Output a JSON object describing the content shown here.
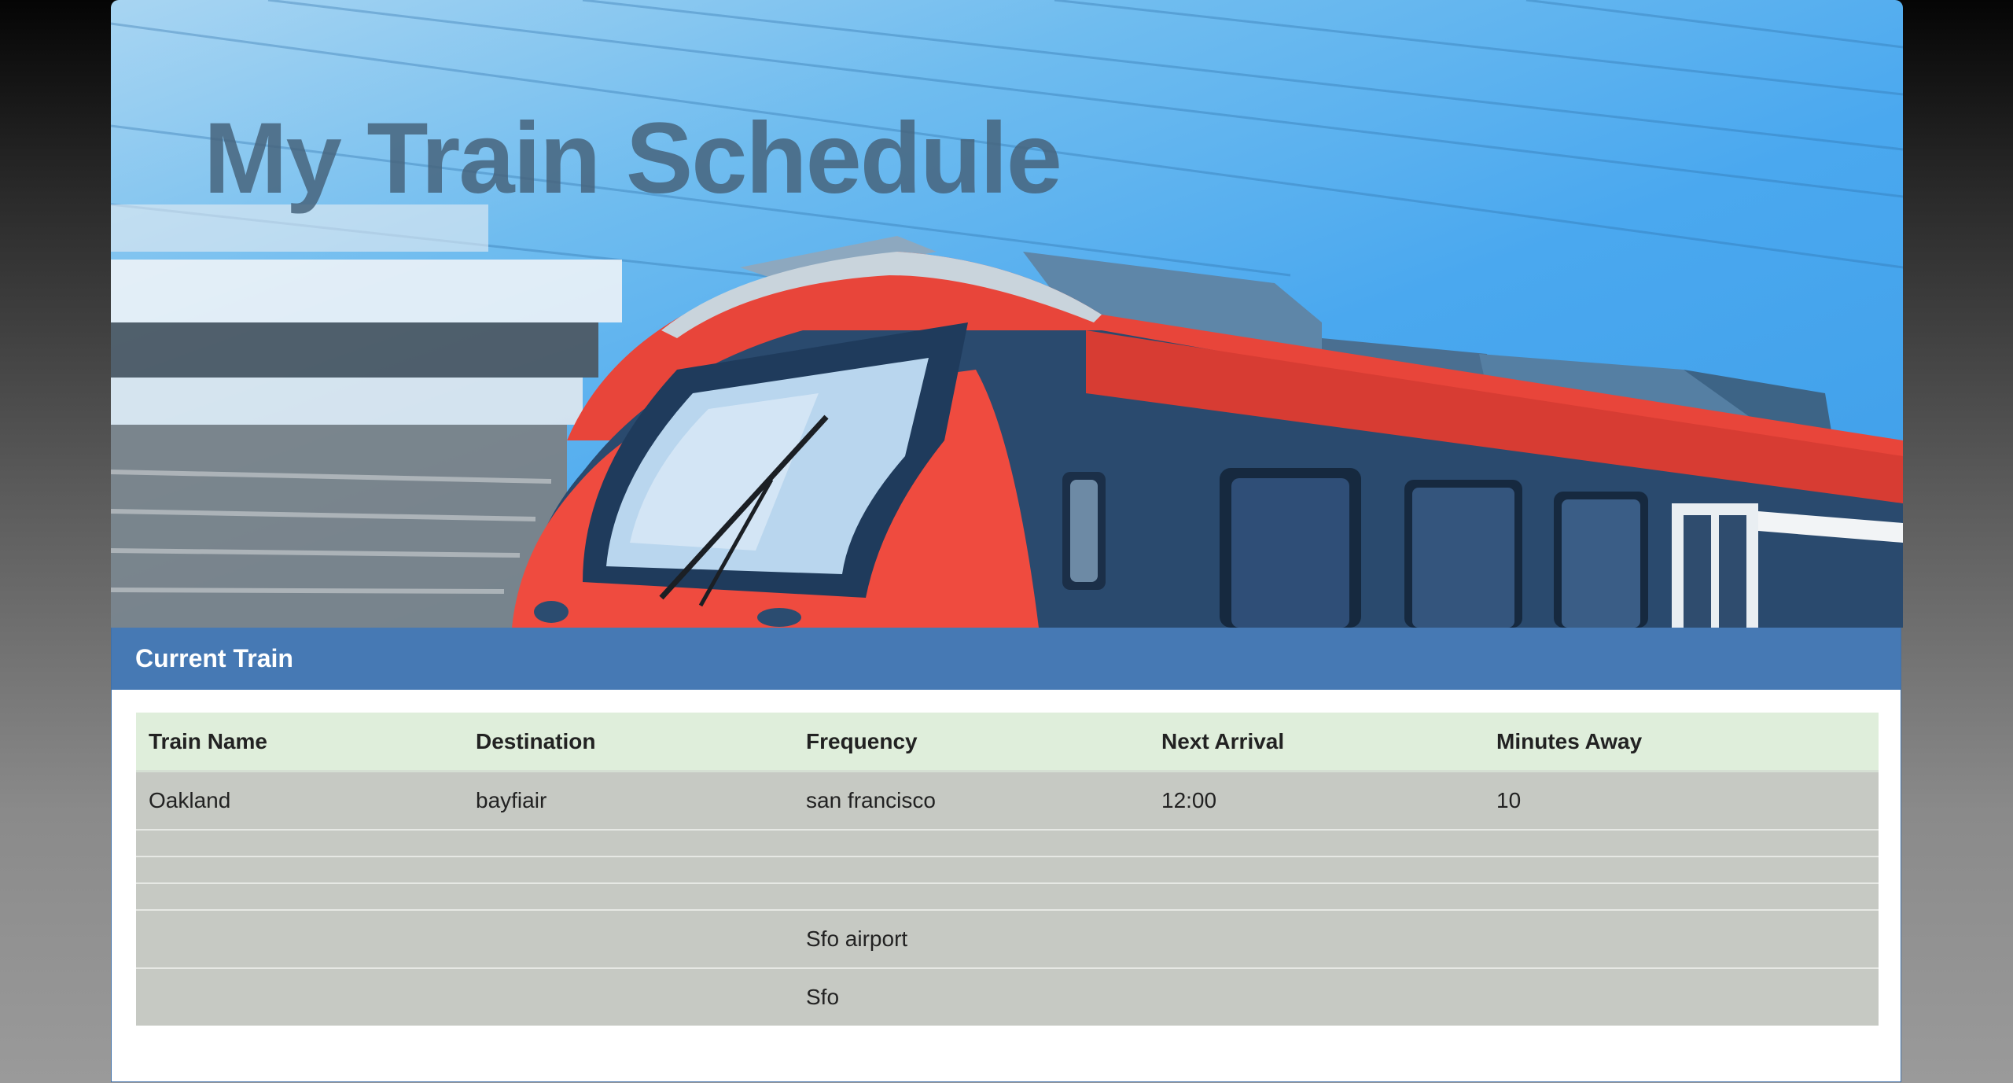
{
  "page": {
    "title": "My Train Schedule"
  },
  "panel": {
    "heading": "Current Train"
  },
  "table": {
    "columns": [
      "Train Name",
      "Destination",
      "Frequency",
      "Next Arrival",
      "Minutes Away"
    ],
    "rows": [
      [
        "Oakland",
        "bayfiair",
        "san francisco",
        "12:00",
        "10"
      ],
      [
        "",
        "",
        "",
        "",
        ""
      ],
      [
        "",
        "",
        "",
        "",
        ""
      ],
      [
        "",
        "",
        "",
        "",
        ""
      ],
      [
        "",
        "",
        "Sfo airport",
        "",
        ""
      ],
      [
        "",
        "",
        "Sfo",
        "",
        ""
      ]
    ]
  },
  "colors": {
    "panel_heading": "#4679b4",
    "table_header": "#dfeedb",
    "table_row": "#c6c9c3",
    "train_red": "#e8453a",
    "sky": "#4aa8ef"
  }
}
